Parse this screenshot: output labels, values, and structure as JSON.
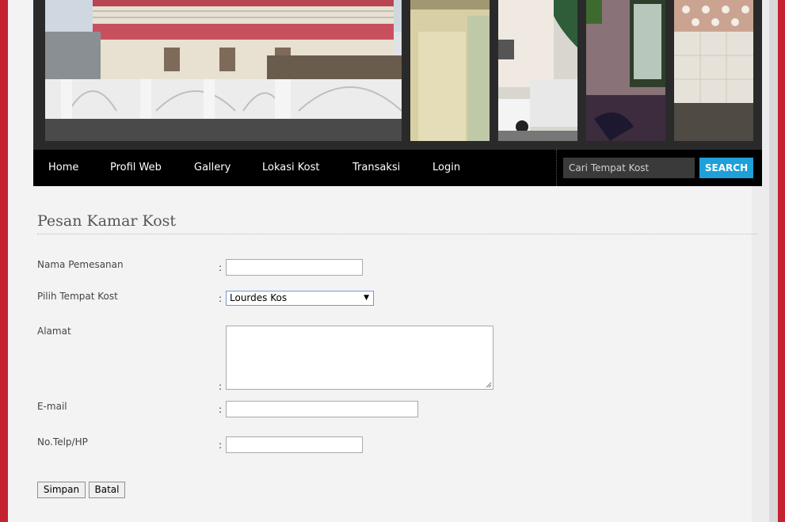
{
  "nav": {
    "items": [
      {
        "label": "Home"
      },
      {
        "label": "Profil Web"
      },
      {
        "label": "Gallery"
      },
      {
        "label": "Lokasi Kost"
      },
      {
        "label": "Transaksi"
      },
      {
        "label": "Login"
      }
    ],
    "search_placeholder": "Cari Tempat Kost",
    "search_button": "SEARCH"
  },
  "form": {
    "title": "Pesan Kamar Kost",
    "colon": ":",
    "fields": {
      "nama": {
        "label": "Nama Pemesanan",
        "value": ""
      },
      "tempat": {
        "label": "Pilih Tempat Kost",
        "selected": "Lourdes Kos"
      },
      "alamat": {
        "label": "Alamat",
        "value": ""
      },
      "email": {
        "label": "E-mail",
        "value": ""
      },
      "telp": {
        "label": "No.Telp/HP",
        "value": ""
      }
    },
    "submit_label": "Simpan",
    "cancel_label": "Batal"
  },
  "colors": {
    "background": "#c4222e",
    "nav": "#000000",
    "search_button": "#1ea0d8"
  }
}
